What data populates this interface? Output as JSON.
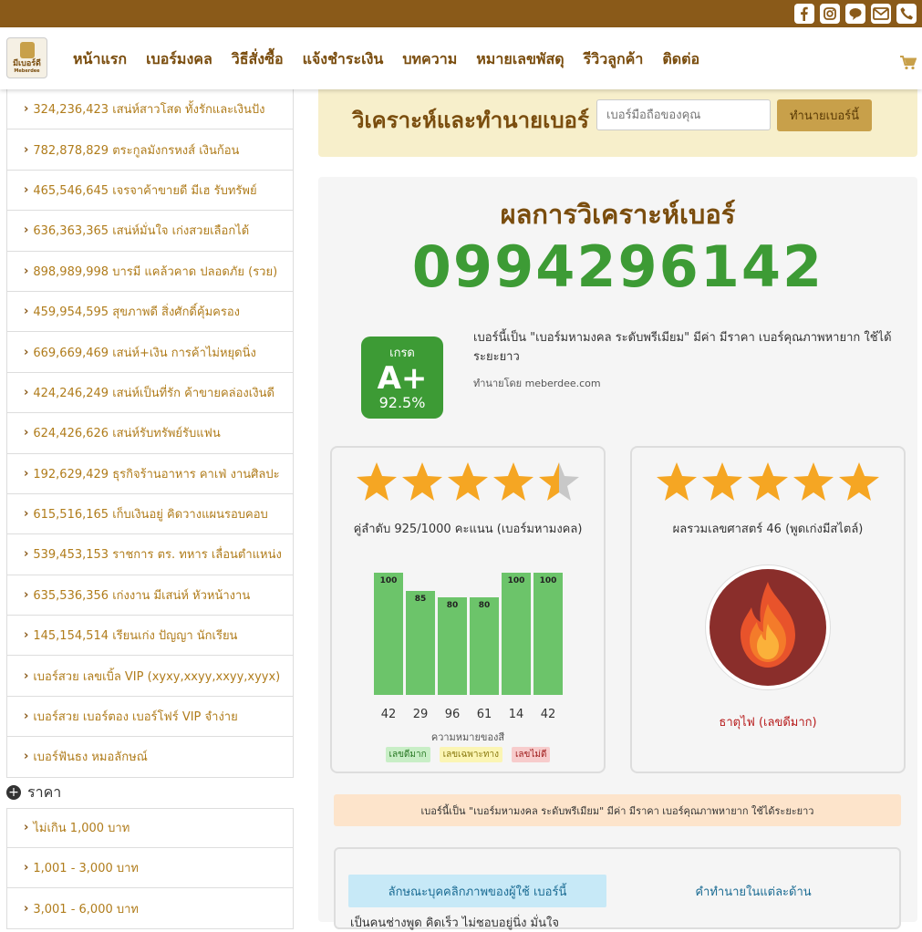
{
  "topbar": {
    "icons": [
      "facebook-icon",
      "instagram-icon",
      "line-icon",
      "mail-icon",
      "phone-icon"
    ]
  },
  "nav": {
    "logo_text": "มีเบอร์ดี",
    "logo_sub": "Meberdee",
    "items": [
      "หน้าแรก",
      "เบอร์มงคล",
      "วิธีสั่งซื้อ",
      "แจ้งชำระเงิน",
      "บทความ",
      "หมายเลขพัสดุ",
      "รีวิวลูกค้า",
      "ติดต่อ"
    ]
  },
  "sidebar": {
    "items": [
      "324,236,423 เสน่ห์สาวโสด ทั้งรักและเงินปัง",
      "782,878,829 ตระกูลมังกรหงส์ เงินก้อน",
      "465,546,645 เจรจาค้าขายดี มีเฮ รับทรัพย์",
      "636,363,365 เสน่ห์มั่นใจ เก่งสวยเลือกได้",
      "898,989,998 บารมี แคล้วคาด ปลอดภัย (รวย)",
      "459,954,595 สุขภาพดี สิ่งศักดิ์คุ้มครอง",
      "669,669,469 เสน่ห์+เงิน การค้าไม่หยุดนิ่ง",
      "424,246,249 เสน่ห์เป็นที่รัก ค้าขายคล่องเงินดี",
      "624,426,626 เสน่ห์รับทรัพย์รับแฟน",
      "192,629,429 ธุรกิจร้านอาหาร คาเฟ่ งานศิลปะ",
      "615,516,165 เก็บเงินอยู่ คิดวางแผนรอบคอบ",
      "539,453,153 ราชการ ตร. ทหาร เลื่อนตำแหน่ง",
      "635,536,356 เก่งงาน มีเสน่ห์ หัวหน้างาน",
      "145,154,514 เรียนเก่ง ปัญญา นักเรียน",
      "เบอร์สวย เลขเบิ้ล VIP (xyxy,xxyy,xxyy,xyyx)",
      "เบอร์สวย เบอร์ตอง เบอร์โฟร์ VIP จำง่าย",
      "เบอร์ฟันธง หมอลักษณ์"
    ],
    "price_heading": "ราคา",
    "price_items": [
      "ไม่เกิน 1,000 บาท",
      "1,001 - 3,000 บาท",
      "3,001 - 6,000 บาท"
    ]
  },
  "banner": {
    "title": "วิเคราะห์และทำนายเบอร์",
    "input_placeholder": "เบอร์มือถือของคุณ",
    "button": "ทำนายเบอร์นี้"
  },
  "result": {
    "title": "ผลการวิเคราะห์เบอร์",
    "number": "0994296142",
    "grade_label": "เกรด",
    "grade": "A+",
    "grade_percent": "92.5%",
    "description": "เบอร์นี้เป็น \"เบอร์มหามงคล ระดับพรีเมียม\" มีค่า มีราคา เบอร์คุณภาพหายาก ใช้ได้ระยะยาว",
    "predicted_by": "ทำนายโดย meberdee.com",
    "left_card": {
      "rating": 4.5,
      "label": "คู่ลำดับ 925/1000 คะแนน (เบอร์มหามงคล)",
      "chart_title": "ความหมายของสี",
      "legend": [
        "เลขดีมาก",
        "เลขเฉพาะทาง",
        "เลขไม่ดี"
      ]
    },
    "right_card": {
      "rating": 5,
      "label": "ผลรวมเลขศาสตร์ 46 (พูดเก่งมีสไตล์)",
      "element": "ธาตุไฟ (เลขดีมาก)"
    },
    "note": "เบอร์นี้เป็น \"เบอร์มหามงคล ระดับพรีเมียม\" มีค่า มีราคา เบอร์คุณภาพหายาก ใช้ได้ระยะยาว",
    "section": {
      "tab_personality": "ลักษณะบุคคลิกภาพของผู้ใช้ เบอร์นี้",
      "tab_prediction": "คำทำนายในแต่ละด้าน",
      "cut_text": "เป็นคนช่างพูด คิดเร็ว ไม่ชอบอยู่นิ่ง มั่นใจ"
    }
  },
  "colors": {
    "brand": "#8a5a19",
    "green": "#3d9b35",
    "bar": "#6cc46a",
    "star": "#f5a623"
  },
  "chart_data": {
    "type": "bar",
    "categories": [
      "42",
      "29",
      "96",
      "61",
      "14",
      "42"
    ],
    "values": [
      100,
      85,
      80,
      80,
      100,
      100
    ],
    "xlabel": "ความหมายของสี",
    "ylim": [
      0,
      100
    ]
  }
}
